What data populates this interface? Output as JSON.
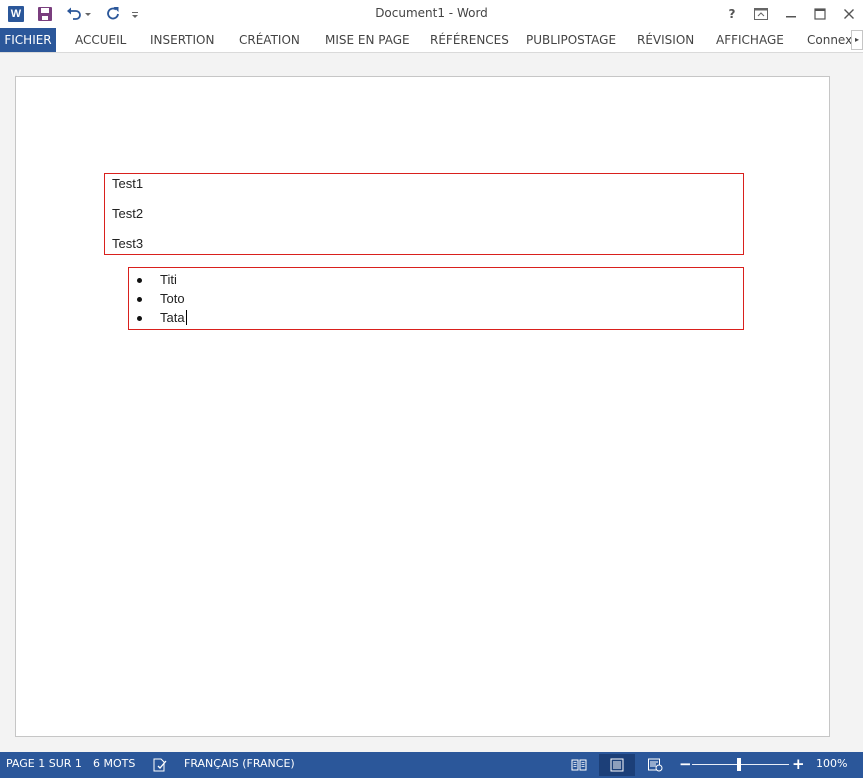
{
  "app": {
    "title": "Document1 - Word",
    "logo_letter": "W"
  },
  "window_controls": {
    "help": "?"
  },
  "ribbon": {
    "tabs": [
      {
        "label": "FICHIER"
      },
      {
        "label": "ACCUEIL"
      },
      {
        "label": "INSERTION"
      },
      {
        "label": "CRÉATION"
      },
      {
        "label": "MISE EN PAGE"
      },
      {
        "label": "RÉFÉRENCES"
      },
      {
        "label": "PUBLIPOSTAGE"
      },
      {
        "label": "RÉVISION"
      },
      {
        "label": "AFFICHAGE"
      },
      {
        "label": "Connexi"
      }
    ]
  },
  "document": {
    "paragraphs": [
      "Test1",
      "Test2",
      "Test3"
    ],
    "bullets": [
      "Titi",
      "Toto",
      "Tata"
    ]
  },
  "statusbar": {
    "page": "PAGE 1 SUR 1",
    "words": "6 MOTS",
    "language": "FRANÇAIS (FRANCE)",
    "zoom": "100%",
    "zoom_level": 1.0
  },
  "colors": {
    "accent": "#2b579a",
    "text_box_border": "#d9201d"
  },
  "icons": [
    "word-logo-icon",
    "save-icon",
    "undo-icon",
    "redo-icon",
    "customize-icon",
    "help-icon",
    "ribbon-display-icon",
    "minimize-icon",
    "maximize-icon",
    "close-icon",
    "proofing-icon",
    "read-mode-icon",
    "print-layout-icon",
    "web-layout-icon"
  ]
}
